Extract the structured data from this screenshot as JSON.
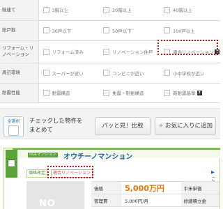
{
  "filters": [
    {
      "label": "階建て",
      "options": [
        "3階以上",
        "20階以上",
        "40階以上"
      ]
    },
    {
      "label": "総戸数",
      "options": [
        "30戸以下",
        "50戸以下",
        "100戸以上"
      ]
    },
    {
      "label": "リフォーム・リノベーション",
      "options": [
        "リフォーム済み",
        "リノベーション住戸",
        "適合リノベーション"
      ]
    },
    {
      "label": "周辺環境",
      "options": [
        "スーパーが近い",
        "コンビニが近い",
        "小中学校が近い"
      ]
    },
    {
      "label": "耐震性能",
      "options": [
        "耐震構造",
        "免震・制振構造",
        "新耐震基準"
      ]
    }
  ],
  "actions": {
    "select_all": "全選択",
    "checked_text_line1": "チェックした物件を",
    "checked_text_line2": "まとめて",
    "compare_button": "パッと見！比較",
    "favorite_button": "お気に入りに追加"
  },
  "property": {
    "type_badge": "中古マンション",
    "name": "オウチーノマンション",
    "tags": [
      "価格改定",
      "適合リノベーション"
    ],
    "more_link": "▶ こ",
    "photo_placeholder": "NO IMAGE",
    "details": [
      {
        "key": "価格",
        "value": "5,000万円",
        "key2": "平米単価",
        "value2": ""
      },
      {
        "key": "管理費",
        "value": "5,000円/月",
        "key2": "修繕積立金",
        "value2": ""
      }
    ]
  },
  "colors": {
    "accent_green": "#5aa43a",
    "link_blue": "#1a5fa8",
    "price_orange": "#e8740c",
    "highlight_red": "#b01d1d"
  }
}
